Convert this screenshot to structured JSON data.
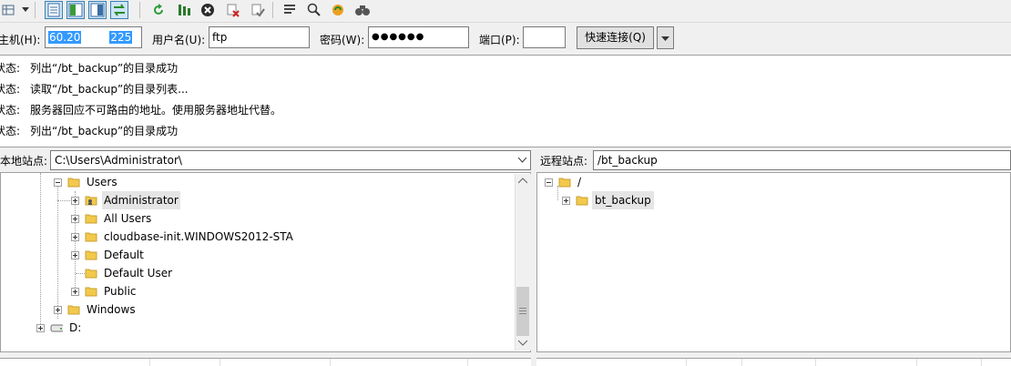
{
  "quickconnect": {
    "host_label": "主机(H):",
    "host_value_a": "60.20",
    "host_value_b": "225",
    "user_label": "用户名(U):",
    "user_value": "ftp",
    "pass_label": "密码(W):",
    "pass_value": "●●●●●●",
    "port_label": "端口(P):",
    "port_value": "",
    "connect_label": "快速连接(Q)"
  },
  "log": [
    {
      "key": "状态:",
      "text": "列出“/bt_backup”的目录成功"
    },
    {
      "key": "状态:",
      "text": "读取“/bt_backup”的目录列表..."
    },
    {
      "key": "状态:",
      "text": "服务器回应不可路由的地址。使用服务器地址代替。"
    },
    {
      "key": "状态:",
      "text": "列出“/bt_backup”的目录成功"
    }
  ],
  "local": {
    "label": "本地站点:",
    "path": "C:\\Users\\Administrator\\",
    "tree": {
      "users": "Users",
      "administrator": "Administrator",
      "all_users": "All Users",
      "cloudbase": "cloudbase-init.WINDOWS2012-STA",
      "default": "Default",
      "default_user": "Default User",
      "public": "Public",
      "windows": "Windows",
      "d_drive": "D:"
    }
  },
  "remote": {
    "label": "远程站点:",
    "path": "/bt_backup",
    "tree": {
      "root": "/",
      "bt_backup": "bt_backup"
    }
  },
  "colors": {
    "selection": "#3399ff",
    "folder": "#f2c94c",
    "selected_button": "#cce4f7"
  }
}
